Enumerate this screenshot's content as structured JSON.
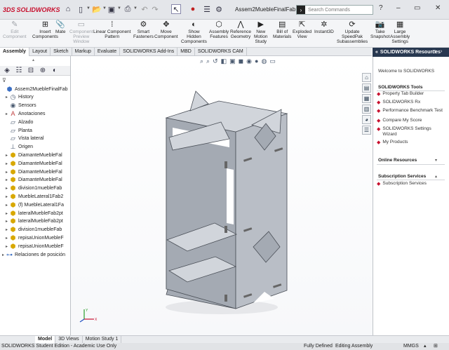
{
  "app": {
    "brand": "SOLIDWORKS",
    "brand_prefix": "3DS",
    "document_title": "Assem2MuebleFinalFab",
    "search_placeholder": "Search Commands"
  },
  "ribbon": [
    {
      "label1": "Edit",
      "label2": "Component",
      "label3": "",
      "icon": "edit-component-icon",
      "disabled": true
    },
    {
      "label1": "Insert",
      "label2": "Components",
      "label3": "",
      "icon": "insert-components-icon",
      "disabled": false
    },
    {
      "label1": "Mate",
      "label2": "",
      "label3": "",
      "icon": "mate-icon",
      "disabled": false
    },
    {
      "label1": "Component",
      "label2": "Preview",
      "label3": "Window",
      "icon": "component-preview-icon",
      "disabled": true
    },
    {
      "label1": "Linear Component",
      "label2": "Pattern",
      "label3": "",
      "icon": "linear-pattern-icon",
      "disabled": false
    },
    {
      "label1": "Smart",
      "label2": "Fasteners",
      "label3": "",
      "icon": "smart-fasteners-icon",
      "disabled": false
    },
    {
      "label1": "Move",
      "label2": "Component",
      "label3": "",
      "icon": "move-component-icon",
      "disabled": false
    },
    {
      "label1": "Show",
      "label2": "Hidden",
      "label3": "Components",
      "icon": "show-hidden-icon",
      "disabled": false
    },
    {
      "label1": "Assembly",
      "label2": "Features",
      "label3": "",
      "icon": "assembly-features-icon",
      "disabled": false
    },
    {
      "label1": "Reference",
      "label2": "Geometry",
      "label3": "",
      "icon": "reference-geometry-icon",
      "disabled": false
    },
    {
      "label1": "New",
      "label2": "Motion",
      "label3": "Study",
      "icon": "motion-study-icon",
      "disabled": false
    },
    {
      "label1": "Bill of",
      "label2": "Materials",
      "label3": "",
      "icon": "bom-icon",
      "disabled": false
    },
    {
      "label1": "Exploded",
      "label2": "View",
      "label3": "",
      "icon": "exploded-view-icon",
      "disabled": false
    },
    {
      "label1": "Instant3D",
      "label2": "",
      "label3": "",
      "icon": "instant3d-icon",
      "disabled": false
    },
    {
      "label1": "Update",
      "label2": "SpeedPak",
      "label3": "Subassemblies",
      "icon": "speedpak-icon",
      "disabled": false
    },
    {
      "label1": "Take",
      "label2": "Snapshot",
      "label3": "",
      "icon": "snapshot-icon",
      "disabled": false
    },
    {
      "label1": "Large",
      "label2": "Assembly",
      "label3": "Settings",
      "icon": "large-assembly-icon",
      "disabled": false
    }
  ],
  "tabs": [
    "Assembly",
    "Layout",
    "Sketch",
    "Markup",
    "Evaluate",
    "SOLIDWORKS Add-Ins",
    "MBD",
    "SOLIDWORKS CAM"
  ],
  "active_tab": "Assembly",
  "tree": [
    {
      "label": "Assem2MuebleFinalFab",
      "icon": "assembly-icon",
      "expander": "",
      "indent": 0
    },
    {
      "label": "History",
      "icon": "history-icon",
      "expander": "▸",
      "indent": 1
    },
    {
      "label": "Sensors",
      "icon": "sensors-icon",
      "expander": "",
      "indent": 1
    },
    {
      "label": "Anotaciones",
      "icon": "annotations-icon",
      "expander": "▸",
      "indent": 1
    },
    {
      "label": "Alzado",
      "icon": "plane-icon",
      "expander": "",
      "indent": 1
    },
    {
      "label": "Planta",
      "icon": "plane-icon",
      "expander": "",
      "indent": 1
    },
    {
      "label": "Vista lateral",
      "icon": "plane-icon",
      "expander": "",
      "indent": 1
    },
    {
      "label": "Origen",
      "icon": "origin-icon",
      "expander": "",
      "indent": 1
    },
    {
      "label": "DiamanteMuebleFal",
      "icon": "part-icon",
      "expander": "▸",
      "indent": 1
    },
    {
      "label": "DiamanteMuebleFal",
      "icon": "part-icon",
      "expander": "▸",
      "indent": 1
    },
    {
      "label": "DiamanteMuebleFal",
      "icon": "part-icon",
      "expander": "▸",
      "indent": 1
    },
    {
      "label": "DiamanteMuebleFal",
      "icon": "part-icon",
      "expander": "▸",
      "indent": 1
    },
    {
      "label": "division1muebleFab",
      "icon": "part-icon",
      "expander": "▸",
      "indent": 1
    },
    {
      "label": "MuebleLateral1Fab2",
      "icon": "part-icon",
      "expander": "▸",
      "indent": 1
    },
    {
      "label": "(f) MuebleLateral1Fa",
      "icon": "part-icon",
      "expander": "▸",
      "indent": 1
    },
    {
      "label": "lateralMuebleFab2pt",
      "icon": "part-icon",
      "expander": "▸",
      "indent": 1
    },
    {
      "label": "lateralMuebleFab2pt",
      "icon": "part-icon",
      "expander": "▸",
      "indent": 1
    },
    {
      "label": "division1muebleFab",
      "icon": "part-icon",
      "expander": "▸",
      "indent": 1
    },
    {
      "label": "repisaUnionMuebleF",
      "icon": "part-icon",
      "expander": "▸",
      "indent": 1
    },
    {
      "label": "repisaUnionMuebleF",
      "icon": "part-icon",
      "expander": "▸",
      "indent": 1
    },
    {
      "label": "Relaciones de posición",
      "icon": "mates-icon",
      "expander": "▸",
      "indent": 0
    }
  ],
  "right_pane": {
    "title": "SOLIDWORKS Resources",
    "welcome": "Welcome to SOLIDWORKS",
    "tools_header": "SOLIDWORKS Tools",
    "tools": [
      "Property Tab Builder",
      "SOLIDWORKS Rx",
      "Performance Benchmark Test",
      "Compare My Score",
      "SOLIDWORKS Settings Wizard",
      "My Products"
    ],
    "online_header": "Online Resources",
    "subscription_header": "Subscription Services",
    "subscription_items": [
      "Subscription Services"
    ]
  },
  "bottom_tabs": [
    "Model",
    "3D Views",
    "Motion Study 1"
  ],
  "active_bottom_tab": "Model",
  "status": {
    "left": "SOLIDWORKS Student Edition - Academic Use Only",
    "state": "Fully Defined",
    "mode": "Editing Assembly",
    "units": "MMGS"
  },
  "colors": {
    "accent": "#c8102e",
    "panel_header": "#283850",
    "model_front": "#a4aab3",
    "model_side": "#b9bec6",
    "model_top": "#d1d5db"
  }
}
